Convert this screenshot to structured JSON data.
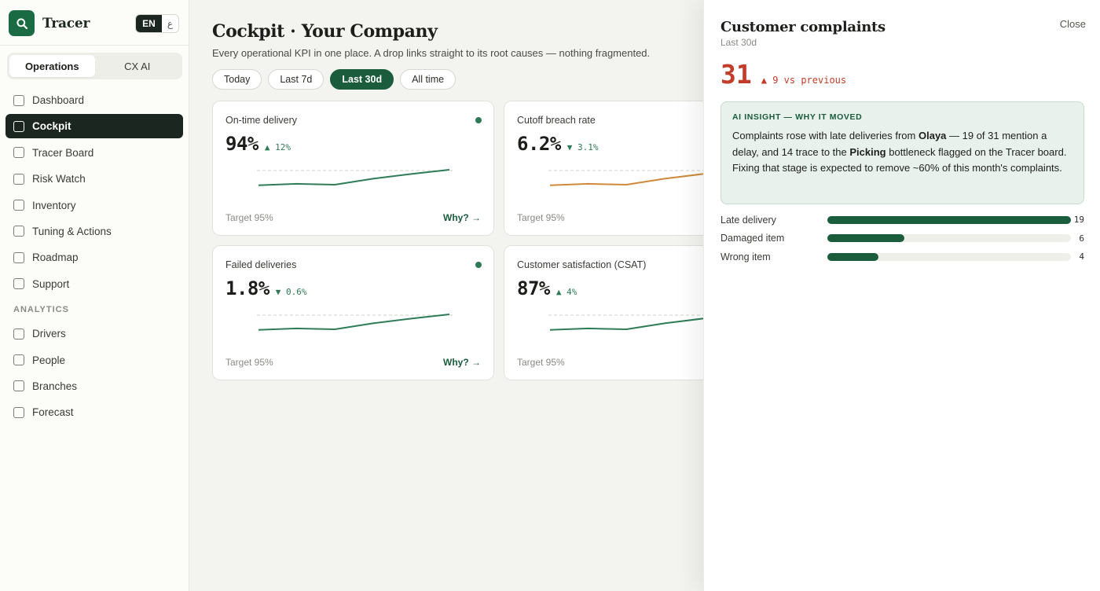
{
  "brand": {
    "name": "Tracer",
    "lang_en": "EN",
    "lang_ar": "ع"
  },
  "sidebar": {
    "tabs": [
      {
        "label": "Operations",
        "active": true
      },
      {
        "label": "CX AI",
        "active": false
      }
    ],
    "items": [
      {
        "label": "Dashboard",
        "active": false
      },
      {
        "label": "Cockpit",
        "active": true
      },
      {
        "label": "Tracer Board",
        "active": false
      },
      {
        "label": "Risk Watch",
        "active": false
      },
      {
        "label": "Inventory",
        "active": false
      },
      {
        "label": "Tuning & Actions",
        "active": false
      },
      {
        "label": "Roadmap",
        "active": false
      },
      {
        "label": "Support",
        "active": false
      }
    ],
    "section_label": "ANALYTICS",
    "analytics_items": [
      {
        "label": "Drivers"
      },
      {
        "label": "People"
      },
      {
        "label": "Branches"
      },
      {
        "label": "Forecast"
      }
    ]
  },
  "main": {
    "title": "Cockpit · Your Company",
    "subtitle": "Every operational KPI in one place. A drop links straight to its root causes — nothing fragmented.",
    "filters": [
      {
        "label": "Today",
        "active": false
      },
      {
        "label": "Last 7d",
        "active": false
      },
      {
        "label": "Last 30d",
        "active": true
      },
      {
        "label": "All time",
        "active": false
      }
    ],
    "cards": [
      {
        "label": "On-time delivery",
        "value": "94%",
        "delta": "▲ 12%",
        "target": "Target 95%",
        "why": "Why? →",
        "has_dot": true,
        "line_color": "#2e7d57",
        "trend": [
          0.4,
          0.45,
          0.42,
          0.62,
          0.78,
          0.92
        ]
      },
      {
        "label": "Cutoff breach rate",
        "value": "6.2%",
        "delta": "▼ 3.1%",
        "target": "Target 95%",
        "why": "",
        "has_dot": false,
        "line_color": "#d08a3a",
        "trend": [
          0.4,
          0.45,
          0.42,
          0.62,
          0.78,
          0.92
        ]
      },
      {
        "label": "Failed deliveries",
        "value": "1.8%",
        "delta": "▼ 0.6%",
        "target": "Target 95%",
        "why": "Why? →",
        "has_dot": true,
        "line_color": "#2e7d57",
        "trend": [
          0.4,
          0.45,
          0.42,
          0.62,
          0.78,
          0.92
        ]
      },
      {
        "label": "Customer satisfaction (CSAT)",
        "value": "87%",
        "delta": "▲ 4%",
        "target": "Target 95%",
        "why": "",
        "has_dot": false,
        "line_color": "#2e7d57",
        "trend": [
          0.4,
          0.45,
          0.42,
          0.62,
          0.78,
          0.92
        ]
      }
    ]
  },
  "drawer": {
    "title": "Customer complaints",
    "period": "Last 30d",
    "close_label": "Close",
    "value": "31",
    "delta": "▲ 9 vs previous",
    "insight_heading": "AI INSIGHT — WHY IT MOVED",
    "insight_parts": [
      "Complaints rose with late deliveries from ",
      "Olaya",
      " — 19 of 31 mention a delay, and 14 trace to the ",
      "Picking",
      " bottleneck flagged on the Tracer board. Fixing that stage is expected to remove ~60% of this month's complaints."
    ],
    "breakdown": [
      {
        "label": "Late delivery",
        "value": 19
      },
      {
        "label": "Damaged item",
        "value": 6
      },
      {
        "label": "Wrong item",
        "value": 4
      }
    ],
    "accent": "#1a5c3c",
    "alert_color": "#c23c2a"
  }
}
